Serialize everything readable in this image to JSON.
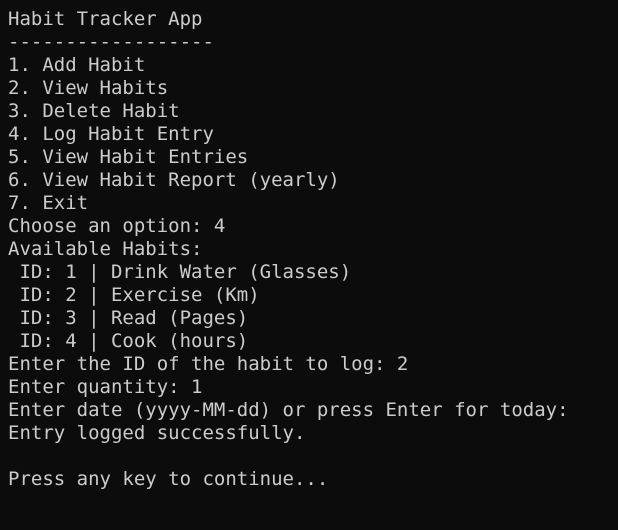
{
  "app": {
    "title": "Habit Tracker App",
    "separator": "------------------"
  },
  "menu": [
    "1. Add Habit",
    "2. View Habits",
    "3. Delete Habit",
    "4. Log Habit Entry",
    "5. View Habit Entries",
    "6. View Habit Report (yearly)",
    "7. Exit"
  ],
  "prompt_option": "Choose an option: 4",
  "habits_header": "Available Habits:",
  "habits": [
    " ID: 1 | Drink Water (Glasses)",
    " ID: 2 | Exercise (Km)",
    " ID: 3 | Read (Pages)",
    " ID: 4 | Cook (hours)"
  ],
  "prompts": {
    "habit_id": "Enter the ID of the habit to log: 2",
    "quantity": "Enter quantity: 1",
    "date": "Enter date (yyyy-MM-dd) or press Enter for today:",
    "result": "Entry logged successfully."
  },
  "continue_prompt": "Press any key to continue..."
}
